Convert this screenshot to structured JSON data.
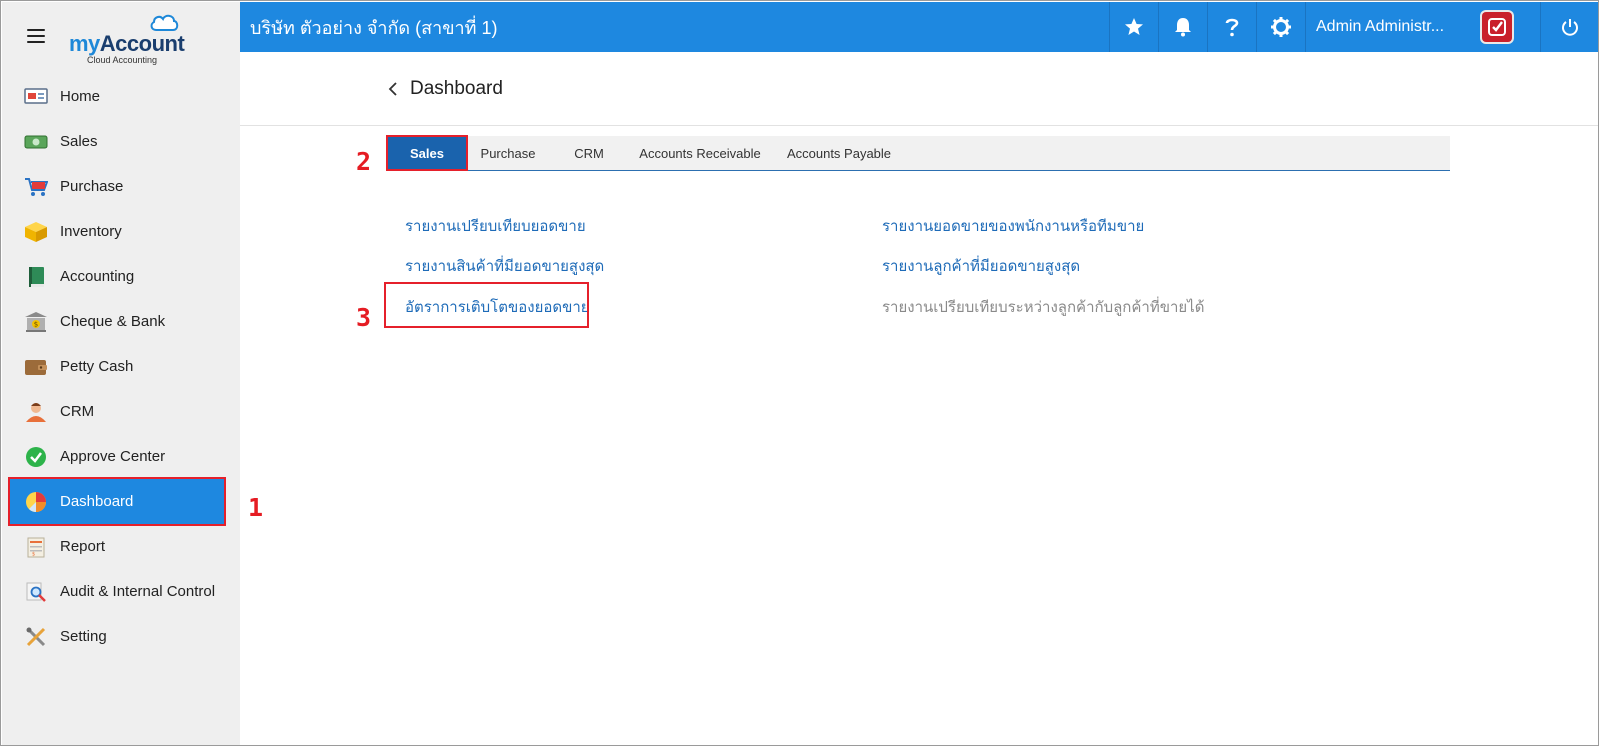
{
  "app": {
    "brand_prefix": "my",
    "brand_name": "Account",
    "brand_tagline": "Cloud Accounting"
  },
  "sidebar": {
    "items": [
      {
        "label": "Home",
        "icon": "monitor-icon"
      },
      {
        "label": "Sales",
        "icon": "money-icon"
      },
      {
        "label": "Purchase",
        "icon": "cart-icon"
      },
      {
        "label": "Inventory",
        "icon": "box-icon"
      },
      {
        "label": "Accounting",
        "icon": "ledger-book-icon"
      },
      {
        "label": "Cheque & Bank",
        "icon": "bank-icon"
      },
      {
        "label": "Petty Cash",
        "icon": "wallet-icon"
      },
      {
        "label": "CRM",
        "icon": "person-icon"
      },
      {
        "label": "Approve Center",
        "icon": "check-circle-icon"
      },
      {
        "label": "Dashboard",
        "icon": "pie-chart-icon",
        "active": true
      },
      {
        "label": "Report",
        "icon": "report-icon"
      },
      {
        "label": "Audit & Internal Control",
        "icon": "magnifier-icon"
      },
      {
        "label": "Setting",
        "icon": "tools-icon"
      }
    ]
  },
  "topbar": {
    "company": "บริษัท ตัวอย่าง จำกัด (สาขาที่ 1)",
    "user_name": "Admin Administr...",
    "icons": [
      "star-icon",
      "bell-icon",
      "help-icon",
      "gear-icon",
      "power-icon"
    ]
  },
  "page": {
    "title": "Dashboard"
  },
  "tabs": [
    {
      "label": "Sales",
      "active": true
    },
    {
      "label": "Purchase"
    },
    {
      "label": "CRM"
    },
    {
      "label": "Accounts Receivable"
    },
    {
      "label": "Accounts Payable"
    }
  ],
  "reports": {
    "left": [
      "รายงานเปรียบเทียบยอดขาย",
      "รายงานสินค้าที่มียอดขายสูงสุด",
      "อัตราการเติบโตของยอดขาย"
    ],
    "right": [
      "รายงานยอดขายของพนักงานหรือทีมขาย",
      "รายงานลูกค้าที่มียอดขายสูงสุด",
      "รายงานเปรียบเทียบระหว่างลูกค้ากับลูกค้าที่ขายได้"
    ]
  },
  "annotations": {
    "step1": "1",
    "step2": "2",
    "step3": "3"
  },
  "colors": {
    "primary": "#1e88e0",
    "tab_active": "#1a63ad",
    "highlight": "#e5202b",
    "link": "#1e6bb8"
  }
}
